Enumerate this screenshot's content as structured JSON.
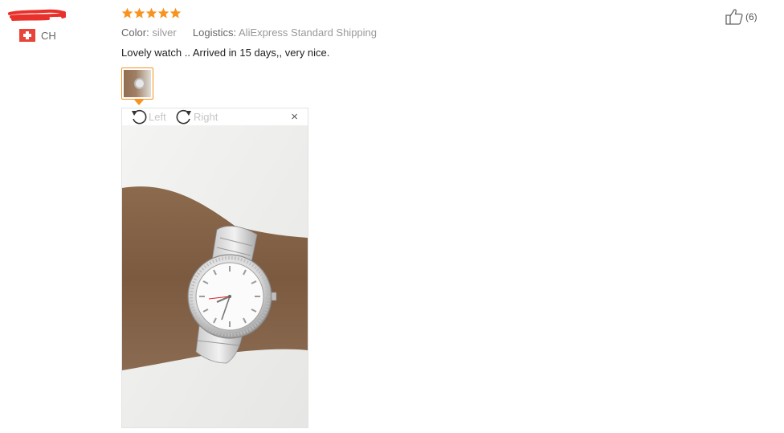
{
  "reviewer": {
    "country_code": "CH",
    "flag_icon": "swiss-flag-icon"
  },
  "review": {
    "rating": 5,
    "max_rating": 5,
    "color_label": "Color:",
    "color_value": "silver",
    "logistics_label": "Logistics:",
    "logistics_value": "AliExpress Standard Shipping",
    "text": "Lovely watch .. Arrived in 15 days,, very nice.",
    "helpful_count": "(6)"
  },
  "viewer": {
    "rotate_left_label": "Left",
    "rotate_right_label": "Right",
    "close_label": "×"
  },
  "colors": {
    "star": "#f7931e",
    "thumb_border": "#f7931e",
    "redaction": "#e8312b"
  }
}
